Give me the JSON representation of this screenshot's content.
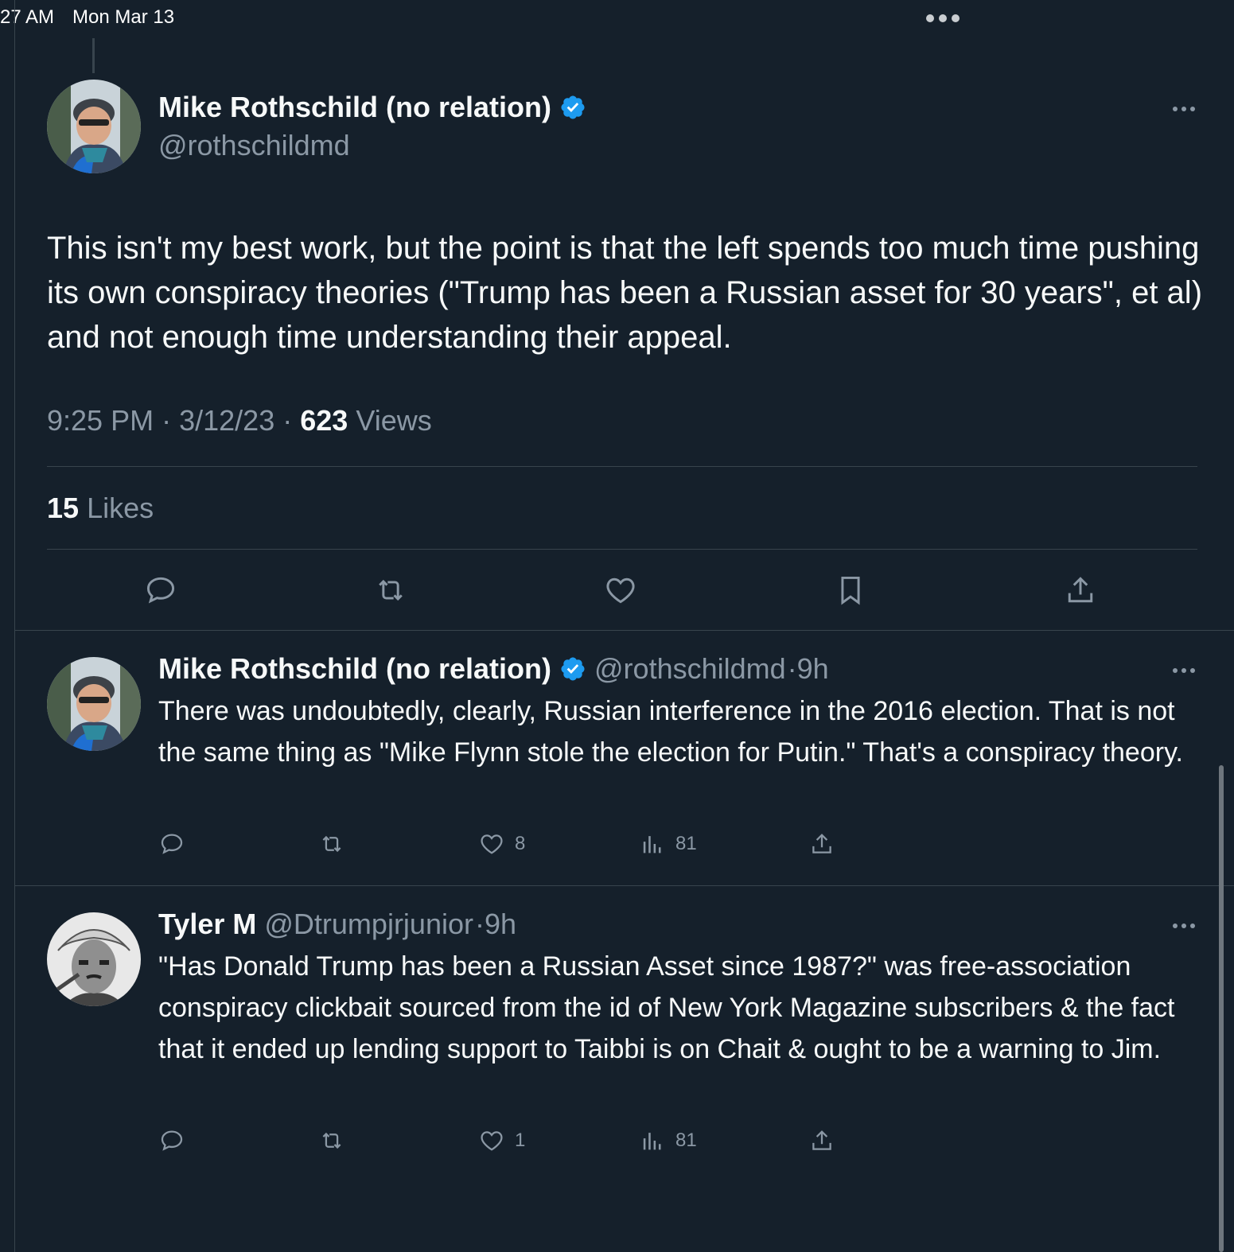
{
  "status_bar": {
    "time": "27 AM",
    "date": "Mon Mar 13"
  },
  "main_tweet": {
    "author_name": "Mike Rothschild (no relation)",
    "handle": "@rothschildmd",
    "text": "This isn't my best work, but the point is that the left spends too much time pushing its own conspiracy theories (\"Trump has been a Russian asset for 30 years\", et al) and not enough time understanding their appeal.",
    "time": "9:25 PM",
    "date": "3/12/23",
    "separator": "·",
    "views_count": "623",
    "views_label": "Views",
    "likes_count": "15",
    "likes_label": "Likes",
    "actions": [
      "reply-icon",
      "retweet-icon",
      "like-icon",
      "bookmark-icon",
      "share-icon"
    ]
  },
  "replies": [
    {
      "author_name": "Mike Rothschild (no relation)",
      "verified": true,
      "handle": "@rothschildmd",
      "time": "·9h",
      "text": "There was undoubtedly, clearly, Russian interference in the 2016 election. That is not the same thing as \"Mike Flynn stole the election for Putin.\" That's a conspiracy theory.",
      "likes": "8",
      "views": "81"
    },
    {
      "author_name": "Tyler M",
      "verified": false,
      "handle": "@Dtrumpjrjunior",
      "time": "·9h",
      "text": "\"Has Donald Trump has been a Russian Asset since 1987?\" was free-association conspiracy clickbait sourced from the id of New York Magazine subscribers & the fact that it ended up lending support to Taibbi is on Chait & ought to be a warning to Jim.",
      "likes": "1",
      "views": "81"
    }
  ],
  "colors": {
    "background": "#15202b",
    "text": "#f7f9f9",
    "muted": "#8b98a5",
    "divider": "#38444d",
    "verified": "#1d9bf0"
  }
}
